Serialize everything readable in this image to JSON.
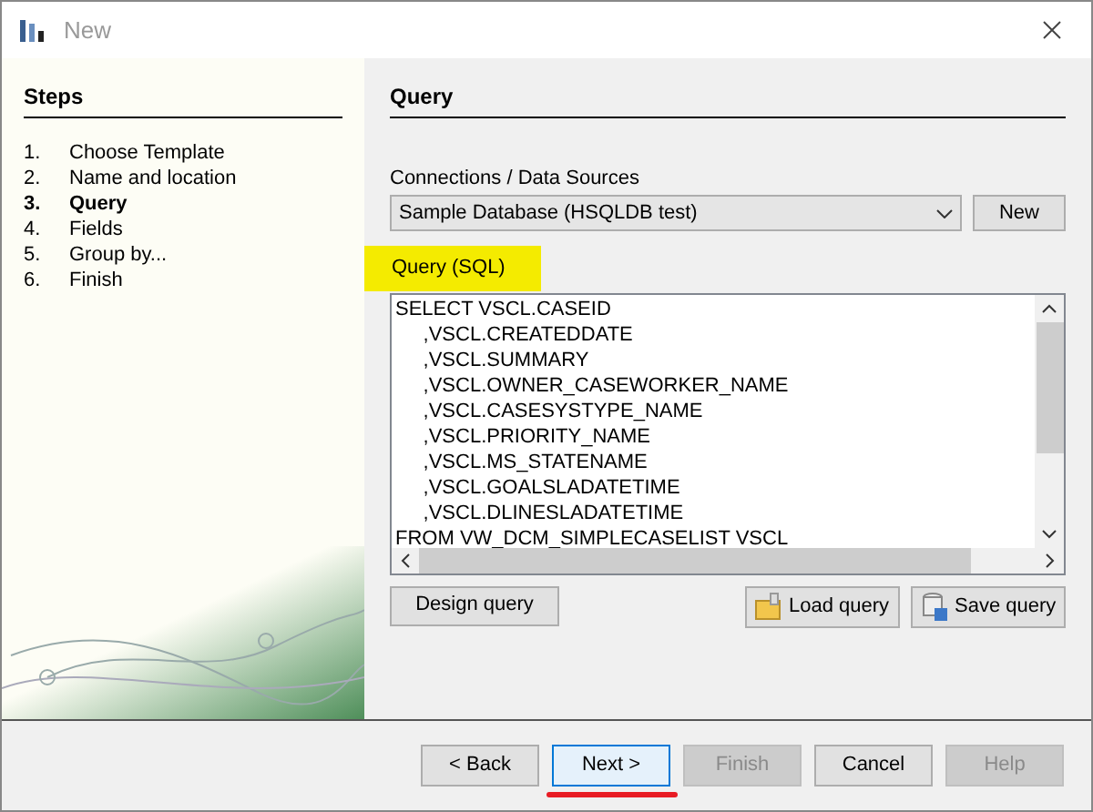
{
  "window": {
    "title": "New"
  },
  "steps": {
    "title": "Steps",
    "items": [
      {
        "number": "1.",
        "label": "Choose Template",
        "selected": false
      },
      {
        "number": "2.",
        "label": "Name and location",
        "selected": false
      },
      {
        "number": "3.",
        "label": "Query",
        "selected": true
      },
      {
        "number": "4.",
        "label": "Fields",
        "selected": false
      },
      {
        "number": "5.",
        "label": "Group by...",
        "selected": false
      },
      {
        "number": "6.",
        "label": "Finish",
        "selected": false
      }
    ]
  },
  "page": {
    "title": "Query",
    "connection_label": "Connections / Data Sources",
    "connection_value": "Sample Database (HSQLDB test)",
    "new_button": "New",
    "query_label": "Query (SQL)",
    "query_label_highlighted": true,
    "query_lines": [
      "SELECT VSCL.CASEID",
      "     ,VSCL.CREATEDDATE",
      "     ,VSCL.SUMMARY",
      "     ,VSCL.OWNER_CASEWORKER_NAME",
      "     ,VSCL.CASESYSTYPE_NAME",
      "     ,VSCL.PRIORITY_NAME",
      "     ,VSCL.MS_STATENAME",
      "     ,VSCL.GOALSLADATETIME",
      "     ,VSCL.DLINESLADATETIME",
      "FROM VW_DCM_SIMPLECASELIST VSCL"
    ],
    "design_button": "Design query",
    "load_button": "Load query",
    "save_button": "Save query"
  },
  "buttons": [
    {
      "label": "< Back",
      "disabled": false,
      "default": false,
      "marked": false
    },
    {
      "label": "Next >",
      "disabled": false,
      "default": true,
      "marked": true
    },
    {
      "label": "Finish",
      "disabled": true,
      "default": false,
      "marked": false
    },
    {
      "label": "Cancel",
      "disabled": false,
      "default": false,
      "marked": false
    },
    {
      "label": "Help",
      "disabled": true,
      "default": false,
      "marked": false
    }
  ]
}
